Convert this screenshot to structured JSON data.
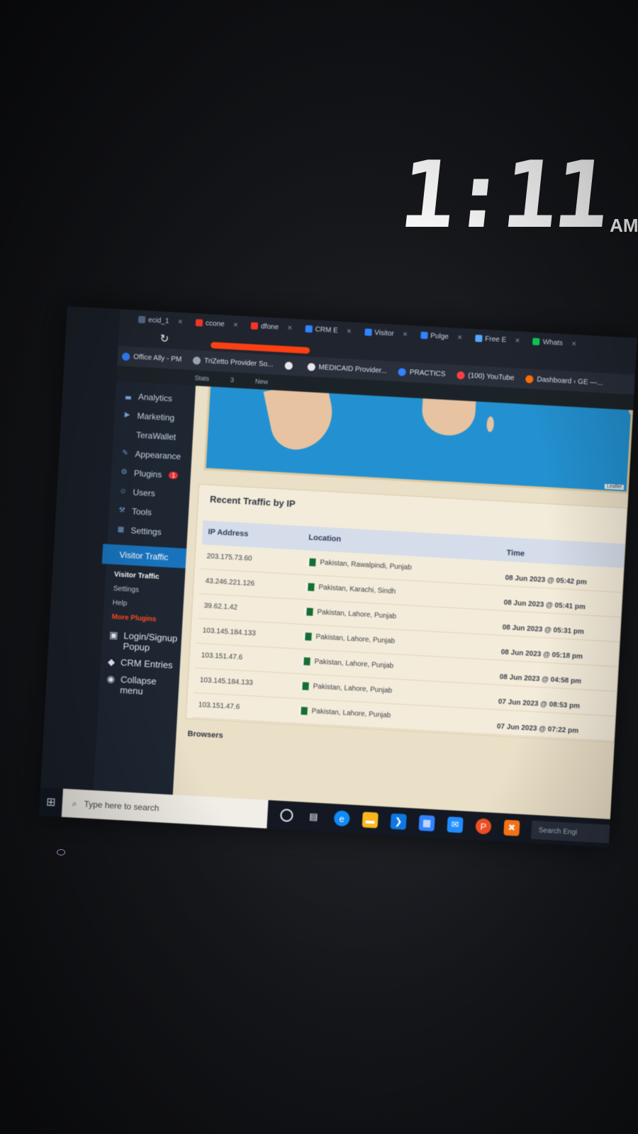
{
  "clock": {
    "time": "1:11",
    "ampm": "AM"
  },
  "browser": {
    "tabs": [
      {
        "label": "ecid_1",
        "color": "#5b6b88"
      },
      {
        "label": "ccone",
        "color": "#e23b2e"
      },
      {
        "label": "dfone",
        "color": "#e23b2e"
      },
      {
        "label": "CRM E",
        "color": "#3b82f6"
      },
      {
        "label": "Visitor",
        "color": "#3b82f6"
      },
      {
        "label": "Pulge",
        "color": "#3b82f6"
      },
      {
        "label": "Free E",
        "color": "#60a5fa"
      },
      {
        "label": "Whats",
        "color": "#22c55e"
      }
    ],
    "bookmarks": [
      {
        "label": "Office Ally - PM",
        "color": "#3b82f6"
      },
      {
        "label": "TriZetto Provider So...",
        "color": "#9ca3af"
      },
      {
        "label": "",
        "color": "#e5e7eb"
      },
      {
        "label": "MEDICAID Provider...",
        "color": "#e5e7eb"
      },
      {
        "label": "PRACTICS",
        "color": "#3b82f6"
      },
      {
        "label": "(100) YouTube",
        "color": "#ef4444"
      },
      {
        "label": "Dashboard ‹ GE —...",
        "color": "#f97316"
      }
    ]
  },
  "adminbar": {
    "items": [
      "Stats",
      "3",
      "New"
    ]
  },
  "sidebar": {
    "items": [
      {
        "label": "Analytics",
        "icon": "chart-icon"
      },
      {
        "label": "Marketing",
        "icon": "megaphone-icon"
      },
      {
        "label": "TeraWallet",
        "icon": "wallet-icon"
      },
      {
        "label": "Appearance",
        "icon": "brush-icon"
      },
      {
        "label": "Plugins",
        "icon": "plugin-icon",
        "badge": "1"
      },
      {
        "label": "Users",
        "icon": "user-icon"
      },
      {
        "label": "Tools",
        "icon": "wrench-icon"
      },
      {
        "label": "Settings",
        "icon": "settings-icon"
      }
    ],
    "active": "Visitor Traffic",
    "submenu": [
      {
        "label": "Visitor Traffic",
        "kind": "current"
      },
      {
        "label": "Settings",
        "kind": "normal"
      },
      {
        "label": "Help",
        "kind": "normal"
      },
      {
        "label": "More Plugins",
        "kind": "more"
      }
    ],
    "extra": [
      {
        "label": "Login/Signup Popup",
        "icon": "lock-icon"
      },
      {
        "label": "CRM Entries",
        "icon": "cube-icon"
      },
      {
        "label": "Collapse menu",
        "icon": "collapse-icon"
      }
    ]
  },
  "traffic": {
    "title": "Recent Traffic by IP",
    "columns": {
      "ip": "IP Address",
      "location": "Location",
      "time": "Time"
    },
    "rows": [
      {
        "ip": "203.175.73.60",
        "location": "Pakistan, Rawalpindi, Punjab",
        "time": "08 Jun 2023 @ 05:42 pm"
      },
      {
        "ip": "43.246.221.126",
        "location": "Pakistan, Karachi, Sindh",
        "time": "08 Jun 2023 @ 05:41 pm"
      },
      {
        "ip": "39.62.1.42",
        "location": "Pakistan, Lahore, Punjab",
        "time": "08 Jun 2023 @ 05:31 pm"
      },
      {
        "ip": "103.145.184.133",
        "location": "Pakistan, Lahore, Punjab",
        "time": "08 Jun 2023 @ 05:18 pm"
      },
      {
        "ip": "103.151.47.6",
        "location": "Pakistan, Lahore, Punjab",
        "time": "08 Jun 2023 @ 04:58 pm"
      },
      {
        "ip": "103.145.184.133",
        "location": "Pakistan, Lahore, Punjab",
        "time": "07 Jun 2023 @ 08:53 pm"
      },
      {
        "ip": "103.151.47.6",
        "location": "Pakistan, Lahore, Punjab",
        "time": "07 Jun 2023 @ 07:22 pm"
      }
    ],
    "next_section": "Browsers"
  },
  "taskbar": {
    "search_placeholder": "Type here to search",
    "right_search": "Search Engi"
  },
  "colors": {
    "map_water": "#2f8fc6",
    "land": "#e4c4a6",
    "accent": "#2271b1",
    "redaction": "#e8451d"
  }
}
